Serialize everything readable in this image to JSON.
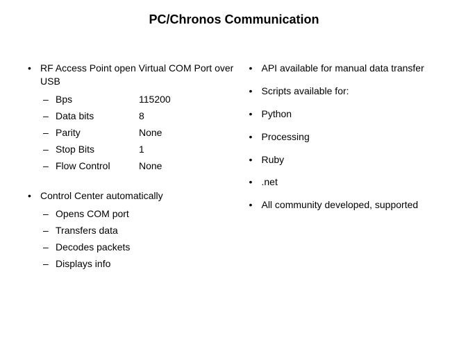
{
  "title": "PC/Chronos Communication",
  "left": {
    "section1": {
      "heading": "RF Access Point open Virtual COM Port over USB",
      "params": [
        {
          "label": "Bps",
          "value": "115200"
        },
        {
          "label": "Data bits",
          "value": "8"
        },
        {
          "label": "Parity",
          "value": "None"
        },
        {
          "label": "Stop Bits",
          "value": "1"
        },
        {
          "label": "Flow Control",
          "value": "None"
        }
      ]
    },
    "section2": {
      "heading": "Control Center automatically",
      "items": [
        "Opens COM port",
        "Transfers data",
        "Decodes packets",
        "Displays info"
      ]
    }
  },
  "right": {
    "items": [
      "API available for manual data transfer",
      "Scripts available for:",
      "Python",
      "Processing",
      "Ruby",
      ".net",
      "All community developed, supported"
    ]
  }
}
